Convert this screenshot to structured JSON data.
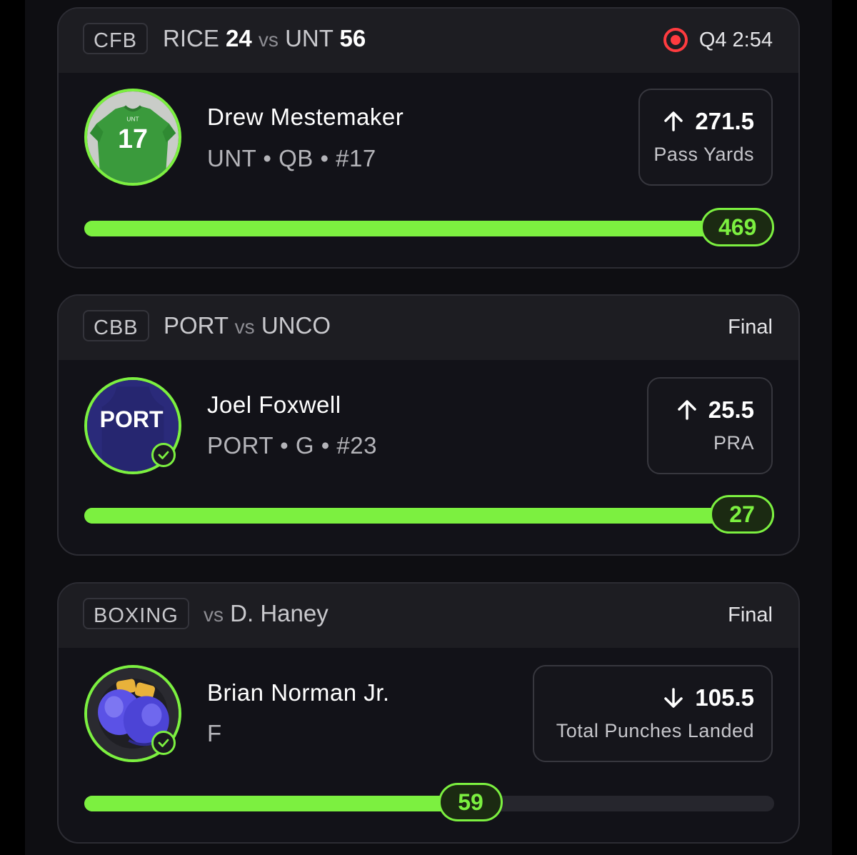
{
  "colors": {
    "accent": "#7cf040",
    "live": "#ff3b3f",
    "card_bg": "#121218",
    "header_bg": "#1d1d22"
  },
  "cards": [
    {
      "league": "CFB",
      "away_team": "RICE",
      "away_score": "24",
      "vs": "vs",
      "home_team": "UNT",
      "home_score": "56",
      "status": "Q4 2:54",
      "live_icon": "live-record-icon",
      "player_name": "Drew Mestemaker",
      "player_meta": "UNT • QB • #17",
      "jersey_team": "UNT",
      "jersey_number": "17",
      "direction": "up",
      "direction_icon": "arrow-up-icon",
      "line": "271.5",
      "stat": "Pass Yards",
      "result": "469",
      "progress": 1.0
    },
    {
      "league": "CBB",
      "away_team": "PORT",
      "vs": "vs",
      "home_team": "UNCO",
      "status": "Final",
      "player_name": "Joel Foxwell",
      "player_meta": "PORT • G • #23",
      "jersey_team": "PORT",
      "direction": "up",
      "direction_icon": "arrow-up-icon",
      "line": "25.5",
      "stat": "PRA",
      "result": "27",
      "progress": 1.0,
      "checked_icon": "check-circle-icon"
    },
    {
      "league": "BOXING",
      "vs": "vs",
      "opponent": "D. Haney",
      "status": "Final",
      "player_name": "Brian Norman Jr.",
      "player_meta": "F",
      "avatar_icon": "boxing-gloves-icon",
      "direction": "down",
      "direction_icon": "arrow-down-icon",
      "line": "105.5",
      "stat": "Total Punches Landed",
      "result": "59",
      "progress": 0.56,
      "checked_icon": "check-circle-icon"
    }
  ]
}
